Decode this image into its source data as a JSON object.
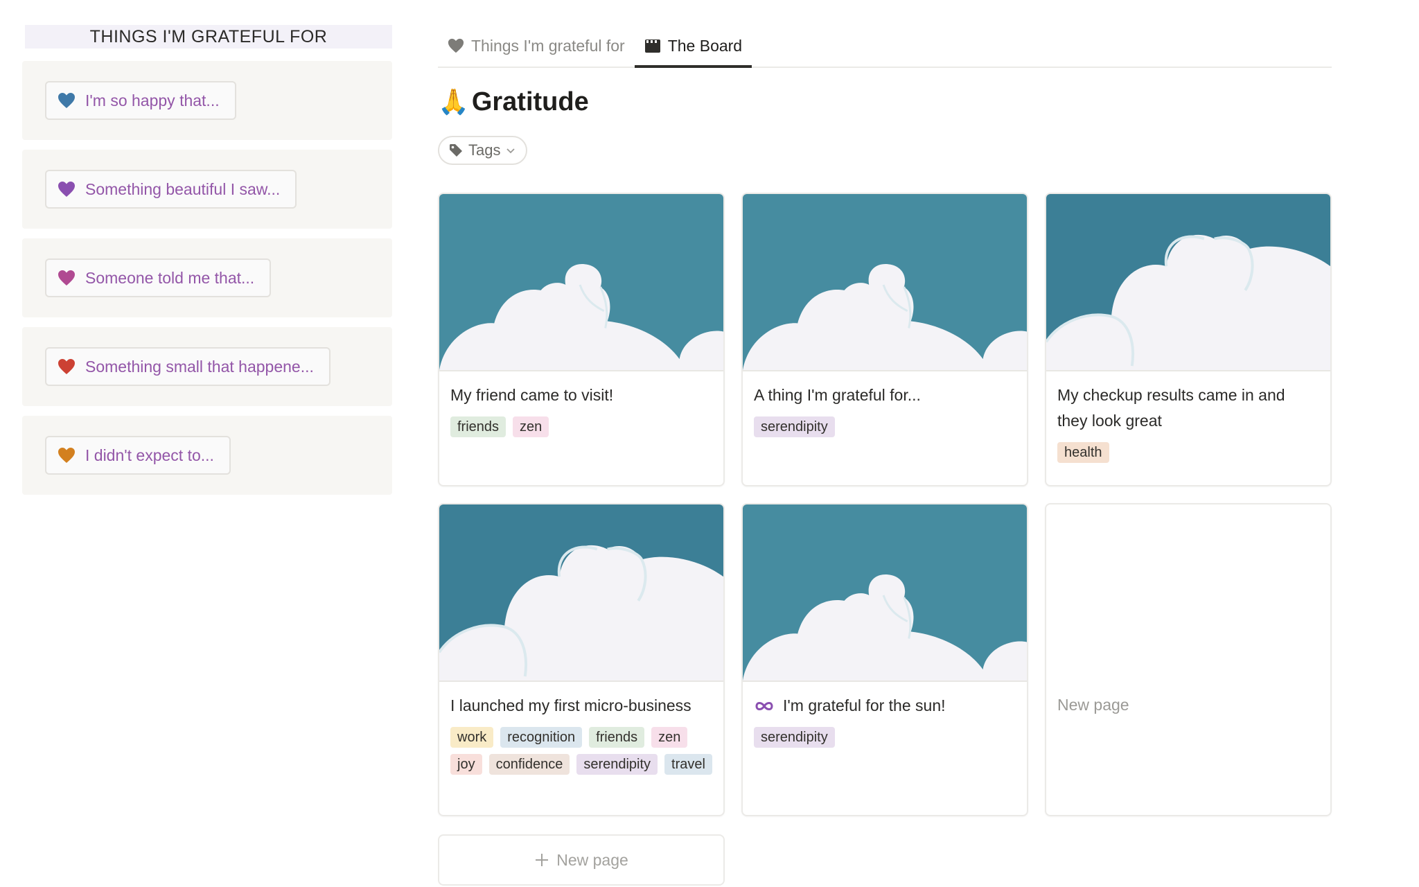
{
  "sidebar": {
    "header": "THINGS I'M GRATEFUL FOR",
    "prompts": [
      {
        "label": "I'm so happy that...",
        "heart_color": "#3f79a8"
      },
      {
        "label": "Something beautiful I saw...",
        "heart_color": "#8a4fb0"
      },
      {
        "label": "Someone told me that...",
        "heart_color": "#b04a92"
      },
      {
        "label": "Something small that happene...",
        "heart_color": "#cc4133"
      },
      {
        "label": "I didn't expect to...",
        "heart_color": "#d3801f"
      }
    ]
  },
  "tabs": [
    {
      "label": "Things I'm grateful for",
      "icon": "heart-icon",
      "active": false
    },
    {
      "label": "The Board",
      "icon": "clapperboard-icon",
      "active": true
    }
  ],
  "page": {
    "emoji": "🙏",
    "title": "Gratitude",
    "filter_label": "Tags"
  },
  "cards": [
    {
      "title": "My friend came to visit!",
      "cover": "cloud-small",
      "tags": [
        {
          "label": "friends",
          "color": "#e0ecdf"
        },
        {
          "label": "zen",
          "color": "#f7dfea"
        }
      ]
    },
    {
      "title": "A thing I'm grateful for...",
      "cover": "cloud-small",
      "tags": [
        {
          "label": "serendipity",
          "color": "#e8deee"
        }
      ]
    },
    {
      "title": "My checkup results came in and they look great",
      "cover": "cloud-large",
      "tags": [
        {
          "label": "health",
          "color": "#f5e0d0"
        }
      ]
    },
    {
      "title": "I launched my first micro-business",
      "cover": "cloud-large",
      "tags": [
        {
          "label": "work",
          "color": "#f9ebc7"
        },
        {
          "label": "recognition",
          "color": "#dbe6ee"
        },
        {
          "label": "friends",
          "color": "#e0ecdf"
        },
        {
          "label": "zen",
          "color": "#f7dfea"
        },
        {
          "label": "joy",
          "color": "#f8dfdb"
        },
        {
          "label": "confidence",
          "color": "#efe3dc"
        },
        {
          "label": "serendipity",
          "color": "#e8deee"
        },
        {
          "label": "travel",
          "color": "#dbe6ee"
        }
      ]
    },
    {
      "title": "I'm grateful for the sun!",
      "cover": "cloud-small",
      "icon": "infinity-icon",
      "tags": [
        {
          "label": "serendipity",
          "color": "#e8deee"
        }
      ]
    },
    {
      "title": "New page",
      "cover": "none",
      "tags": []
    }
  ],
  "new_page_label": "New page",
  "colors": {
    "sky": "#468ca0",
    "sky_dark": "#3c7f96",
    "cloud": "#f4f3f7",
    "cloud_outline": "#dbe9ee",
    "prompt_text": "#9356a8"
  }
}
